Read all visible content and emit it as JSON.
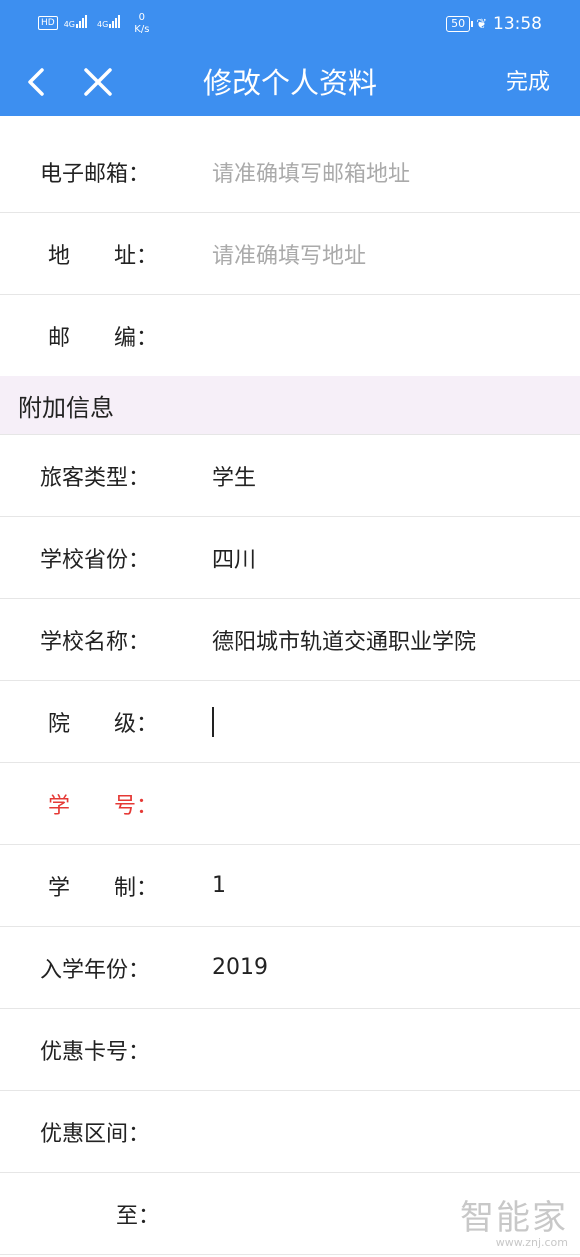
{
  "status_bar": {
    "hd": "HD",
    "net1": "4G",
    "net2": "4G",
    "speed_value": "0",
    "speed_unit": "K/s",
    "battery": "50",
    "time": "13:58"
  },
  "header": {
    "title": "修改个人资料",
    "done_label": "完成",
    "back_icon": "chevron-left-icon",
    "close_icon": "close-icon"
  },
  "contact_fields": [
    {
      "label": "电子邮箱：",
      "value": "",
      "placeholder": "请准确填写邮箱地址"
    },
    {
      "label": "地　　址：",
      "value": "",
      "placeholder": "请准确填写地址"
    },
    {
      "label": "邮　　编：",
      "value": ""
    }
  ],
  "section": {
    "title": "附加信息"
  },
  "extra_fields": [
    {
      "label": "旅客类型：",
      "value": "学生"
    },
    {
      "label": "学校省份：",
      "value": "四川"
    },
    {
      "label": "学校名称：",
      "value": "德阳城市轨道交通职业学院"
    },
    {
      "label": "院　　级：",
      "value": ""
    },
    {
      "label": "学　　号：",
      "value": ""
    },
    {
      "label": "学　　制：",
      "value": "1"
    },
    {
      "label": "入学年份：",
      "value": "2019"
    },
    {
      "label": "优惠卡号：",
      "value": ""
    },
    {
      "label": "优惠区间：",
      "value": ""
    },
    {
      "label": "至：",
      "value": ""
    }
  ],
  "watermark": {
    "main": "智能家",
    "sub": "www.znj.com"
  },
  "colors": {
    "primary": "#3d8ff0",
    "required": "#e53935",
    "section_bg": "#f6eff8"
  }
}
